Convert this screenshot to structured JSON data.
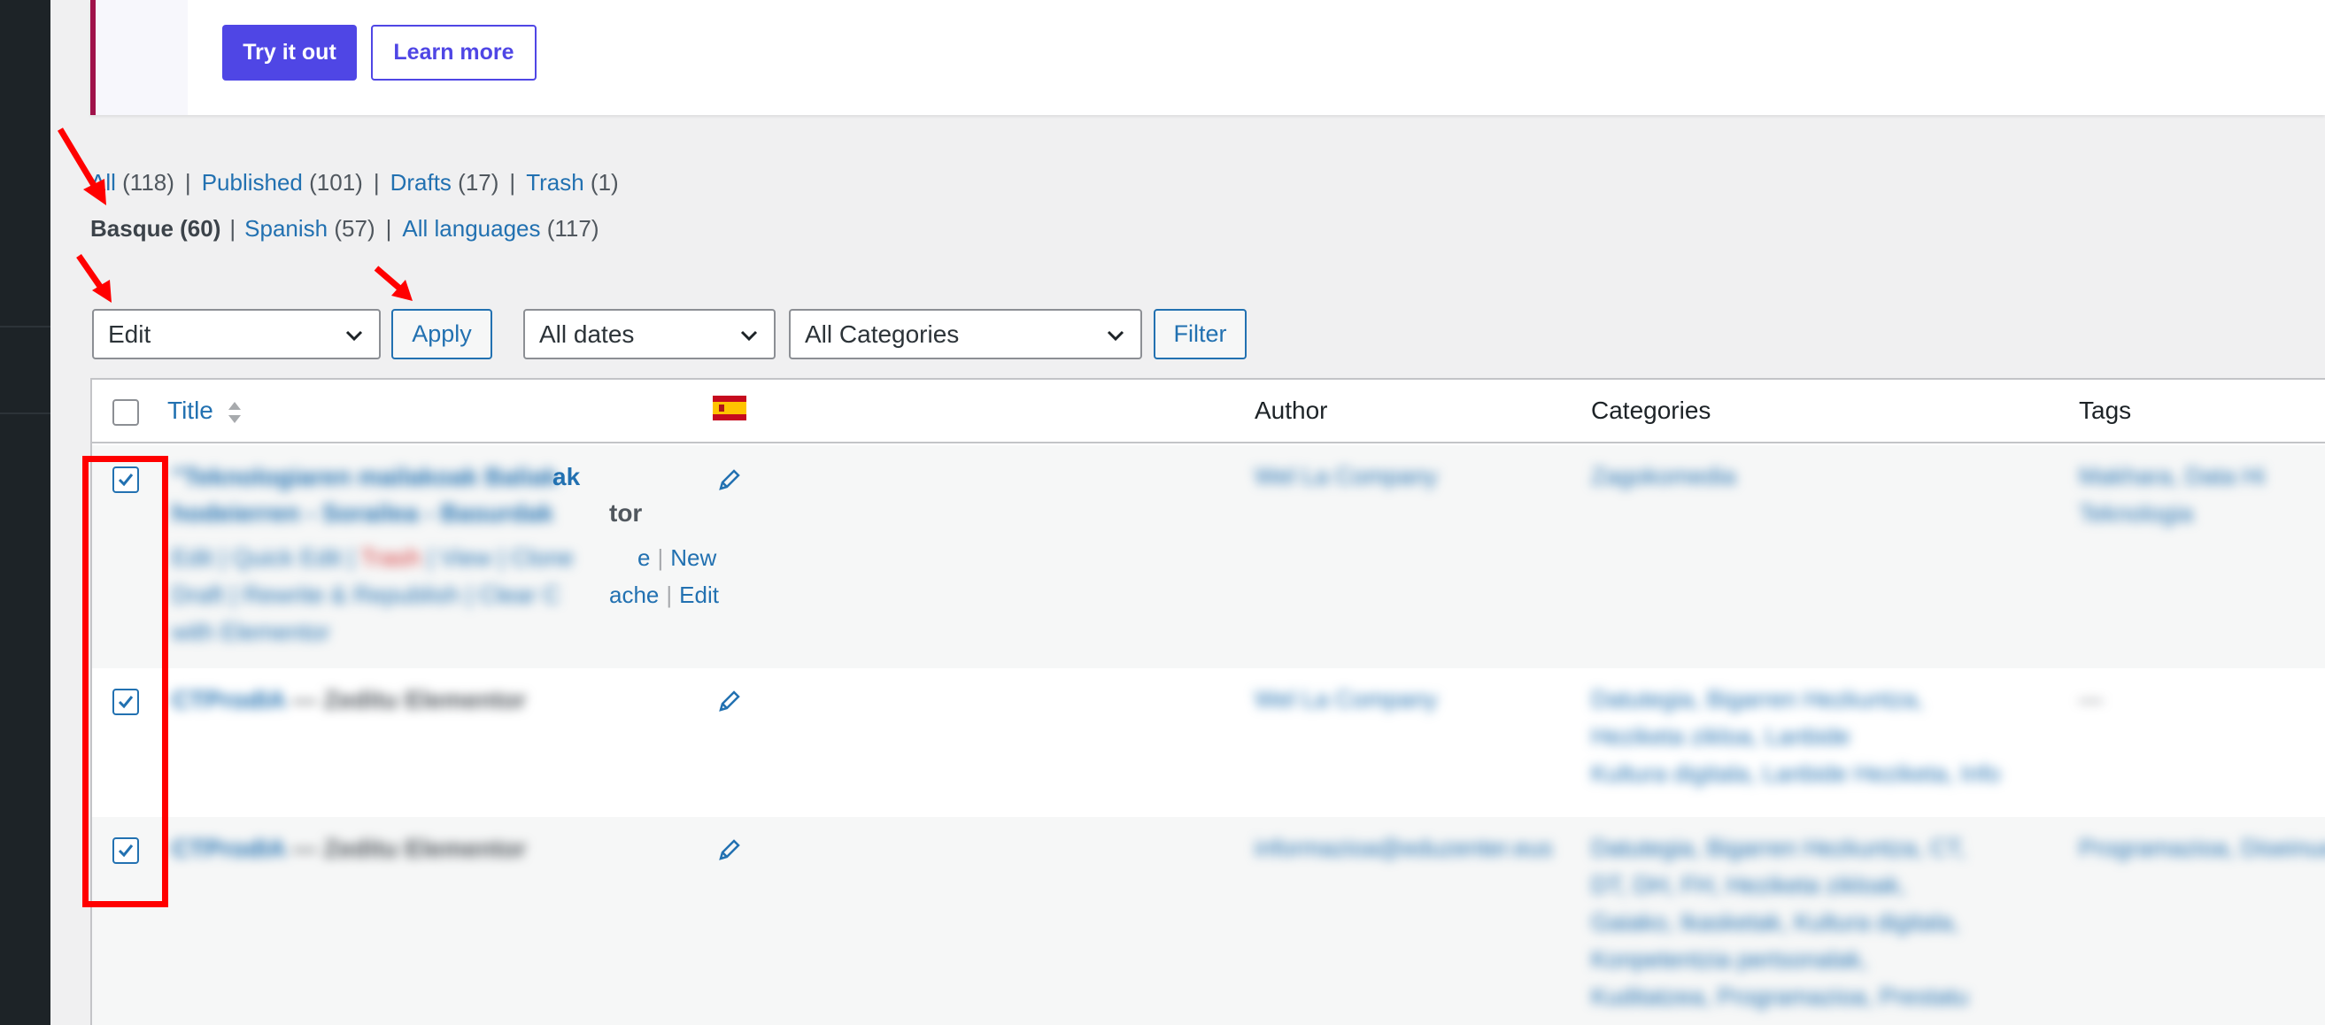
{
  "notice": {
    "try_button": "Try it out",
    "learn_button": "Learn more"
  },
  "status_filters": {
    "all_label": "All",
    "all_count": "(118)",
    "published_label": "Published",
    "published_count": "(101)",
    "drafts_label": "Drafts",
    "drafts_count": "(17)",
    "trash_label": "Trash",
    "trash_count": "(1)"
  },
  "language_filters": {
    "basque": "Basque (60)",
    "spanish_label": "Spanish",
    "spanish_count": "(57)",
    "all_languages_label": "All languages",
    "all_languages_count": "(117)"
  },
  "tablenav": {
    "bulk_action_value": "Edit",
    "apply_label": "Apply",
    "dates_value": "All dates",
    "categories_value": "All Categories",
    "filter_label": "Filter"
  },
  "table": {
    "columns": {
      "title": "Title",
      "author": "Author",
      "categories": "Categories",
      "tags": "Tags"
    },
    "language_column_flag": "spain-flag-icon",
    "rows": [
      {
        "checked": true,
        "title_visible_part": "ak",
        "state_visible_part": "tor",
        "actions_line1_visible": [
          "e",
          "New"
        ],
        "actions_line2_visible": [
          "ache",
          "Edit"
        ]
      },
      {
        "checked": true
      },
      {
        "checked": true
      }
    ]
  },
  "annotations": {
    "highlight_color": "#ff0000"
  }
}
